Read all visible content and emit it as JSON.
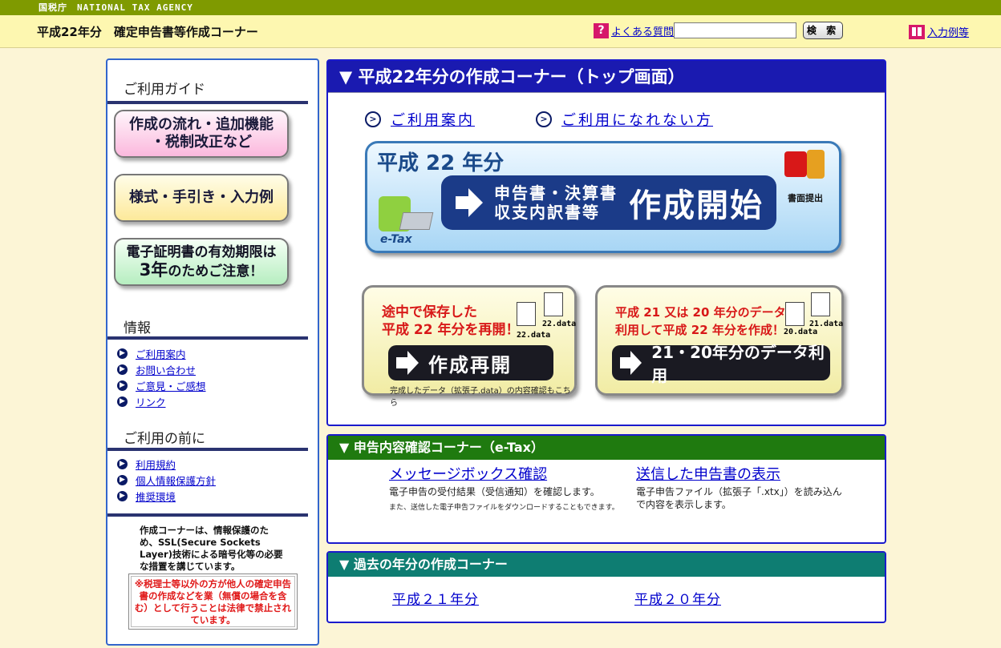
{
  "agency_bar": "国税庁　NATIONAL TAX AGENCY",
  "header": {
    "title": "平成22年分　確定申告書等作成コーナー",
    "faq_icon": "?",
    "faq_label": "よくある質問",
    "search_value": "",
    "search_button": "検 索",
    "input_example": "入力例等"
  },
  "sidebar": {
    "guide_heading": "ご利用ガイド",
    "btn_flow_line1": "作成の流れ・追加機能",
    "btn_flow_line2": "・税制改正など",
    "btn_forms": "様式・手引き・入力例",
    "btn_cert_line1a": "電子証明書の有効期限",
    "btn_cert_line1b": "は",
    "btn_cert_line2a": "3年",
    "btn_cert_line2b": "のためご注意！",
    "info_heading": "情報",
    "info_items": [
      "ご利用案内",
      "お問い合わせ",
      "ご意見・ご感想",
      "リンク"
    ],
    "before_heading": "ご利用の前に",
    "before_items": [
      "利用規約",
      "個人情報保護方針",
      "推奨環境"
    ],
    "ssl_text": "作成コーナーは、情報保護のため、SSL(Secure Sockets Layer)技術による暗号化等の必要な措置を講じています。",
    "warning": "※税理士等以外の方が他人の確定申告書の作成などを業（無償の場合を含む）として行うことは法律で禁止されています。"
  },
  "main": {
    "heading": "▼ 平成22年分の作成コーナー（トップ画面）",
    "link_guide": "ご利用案内",
    "link_newcomer": "ご利用になれない方",
    "start": {
      "year": "平成 22 年分",
      "sub_line1": "申告書・決算書",
      "sub_line2": "収支内訳書等",
      "main": "作成開始",
      "etax": "e-Tax",
      "submit_label": "書面提出"
    },
    "resume": {
      "line1": "途中で保存した",
      "line2": "平成 22 年分を再開！",
      "doc1": "22.data",
      "doc2": "22.data",
      "button": "作成再開",
      "note": "完成したデータ（拡張子.data）の内容確認もこちら"
    },
    "prior": {
      "line1": "平成 21 又は 20 年分のデータを",
      "line2": "利用して平成 22 年分を作成！",
      "doc1": "20.data",
      "doc2": "21.data",
      "button": "21・20年分のデータ利用"
    }
  },
  "confirm": {
    "heading": "▼ 申告内容確認コーナー（e-Tax）",
    "msgbox_title": "メッセージボックス確認",
    "msgbox_desc": "電子申告の受付結果（受信通知）を確認します。",
    "msgbox_small": "また、送信した電子申告ファイルをダウンロードすることもできます。",
    "sent_title": "送信した申告書の表示",
    "sent_desc": "電子申告ファイル（拡張子「.xtx」）を読み込んで内容を表示します。"
  },
  "past": {
    "heading": "▼ 過去の年分の作成コーナー",
    "y21": "平成２１年分",
    "y20": "平成２０年分"
  }
}
